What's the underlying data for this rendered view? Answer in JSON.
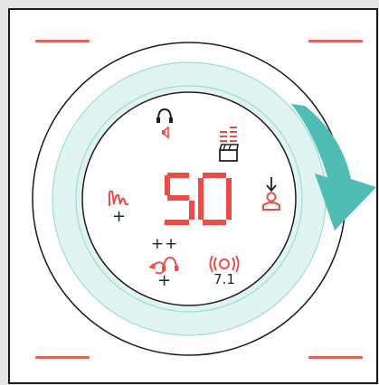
{
  "display": {
    "level_value": "50",
    "level_digits": [
      "5",
      "0"
    ],
    "accent_red": "#ee4d45",
    "ring_teal": "#7fd3c9",
    "arrow_teal": "#4fbdb3",
    "ring_fill": "#dff3f0",
    "line_dark": "#222222"
  },
  "icons": {
    "headset_mic": "headset-speaker-icon",
    "equalizer_clapper": "equalizer-clapperboard-icon",
    "wave_plus": "audio-wave-plus-icon",
    "profile_down": "download-profile-icon",
    "sync_headset": "headset-sync-icon",
    "surround": "surround-sound-icon"
  },
  "labels": {
    "plus_plus": "++",
    "plus": "+",
    "surround_channels": "7.1"
  }
}
